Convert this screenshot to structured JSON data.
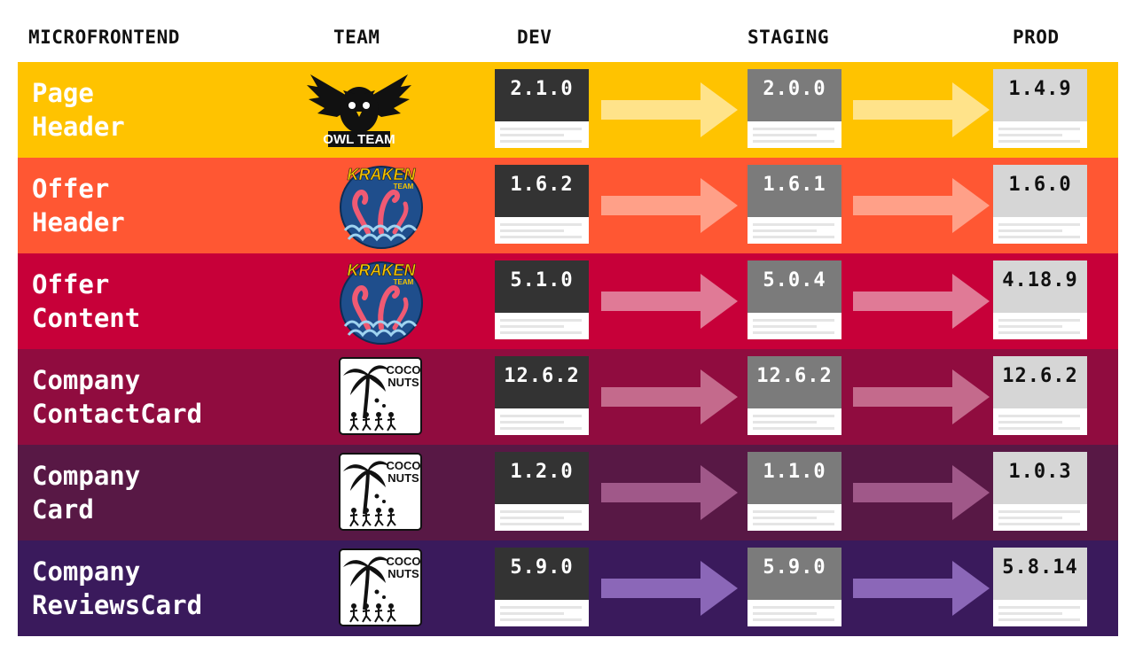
{
  "headers": {
    "microfrontend": "MICROFRONTEND",
    "team": "TEAM",
    "dev": "DEV",
    "staging": "STAGING",
    "prod": "PROD"
  },
  "team_logos": {
    "owl": "OWL TEAM",
    "kraken": "KRAKEN",
    "kraken_sub": "TEAM",
    "coconuts_line1": "COCO",
    "coconuts_line2": "NUTS"
  },
  "rows": [
    {
      "name_line1": "Page",
      "name_line2": "Header",
      "team": "owl",
      "color": "#ffc300",
      "arrow_color": "#ffe38a",
      "dev": "2.1.0",
      "staging": "2.0.0",
      "prod": "1.4.9"
    },
    {
      "name_line1": "Offer",
      "name_line2": "Header",
      "team": "kraken",
      "color": "#ff5733",
      "arrow_color": "#ffa088",
      "dev": "1.6.2",
      "staging": "1.6.1",
      "prod": "1.6.0"
    },
    {
      "name_line1": "Offer",
      "name_line2": "Content",
      "team": "kraken",
      "color": "#c70039",
      "arrow_color": "#e07a96",
      "dev": "5.1.0",
      "staging": "5.0.4",
      "prod": "4.18.9"
    },
    {
      "name_line1": "Company",
      "name_line2": "ContactCard",
      "team": "coconuts",
      "color": "#900c3f",
      "arrow_color": "#c46a8c",
      "dev": "12.6.2",
      "staging": "12.6.2",
      "prod": "12.6.2"
    },
    {
      "name_line1": "Company",
      "name_line2": "Card",
      "team": "coconuts",
      "color": "#581845",
      "arrow_color": "#a05889",
      "dev": "1.2.0",
      "staging": "1.1.0",
      "prod": "1.0.3"
    },
    {
      "name_line1": "Company",
      "name_line2": "ReviewsCard",
      "team": "coconuts",
      "color": "#3a1a5c",
      "arrow_color": "#8b67b8",
      "dev": "5.9.0",
      "staging": "5.9.0",
      "prod": "5.8.14"
    }
  ]
}
